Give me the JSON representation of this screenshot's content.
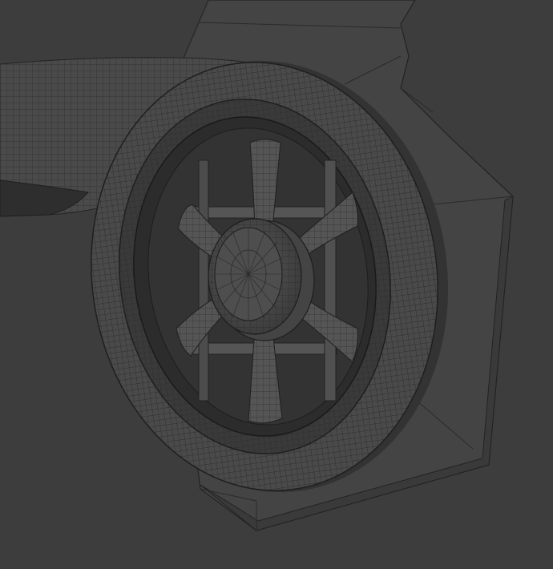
{
  "viewport": {
    "background_color": "#3d3d3d",
    "mesh_fill_color": "#4a4a4a",
    "mesh_dark_color": "#2b2b2b",
    "wire_color": "#1e1e1e",
    "spoke_count": 6,
    "display_mode": "wireframe-overlay"
  }
}
